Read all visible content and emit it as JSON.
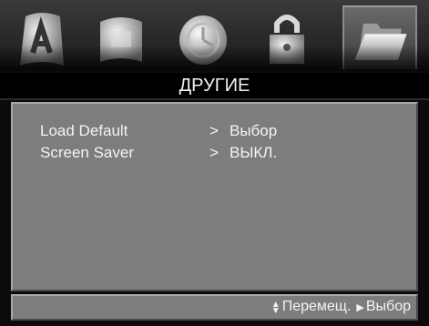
{
  "icons": [
    {
      "name": "picture-icon",
      "selected": false
    },
    {
      "name": "sound-icon",
      "selected": false
    },
    {
      "name": "timer-icon",
      "selected": false
    },
    {
      "name": "lock-icon",
      "selected": false
    },
    {
      "name": "other-folder-icon",
      "selected": true
    }
  ],
  "header": {
    "title": "ДРУГИЕ"
  },
  "menu": [
    {
      "label": "Load Default",
      "arrow": ">",
      "value": "Выбор"
    },
    {
      "label": "Screen Saver",
      "arrow": ">",
      "value": "ВЫКЛ."
    }
  ],
  "help": {
    "move_icon": "up-down-icon",
    "move_label": "Перемещ.",
    "select_icon": "play-icon",
    "select_label": "Выбор"
  },
  "colors": {
    "background": "#0b0b0b",
    "panel": "#7d7d7d",
    "text": "#f4f4f4"
  }
}
